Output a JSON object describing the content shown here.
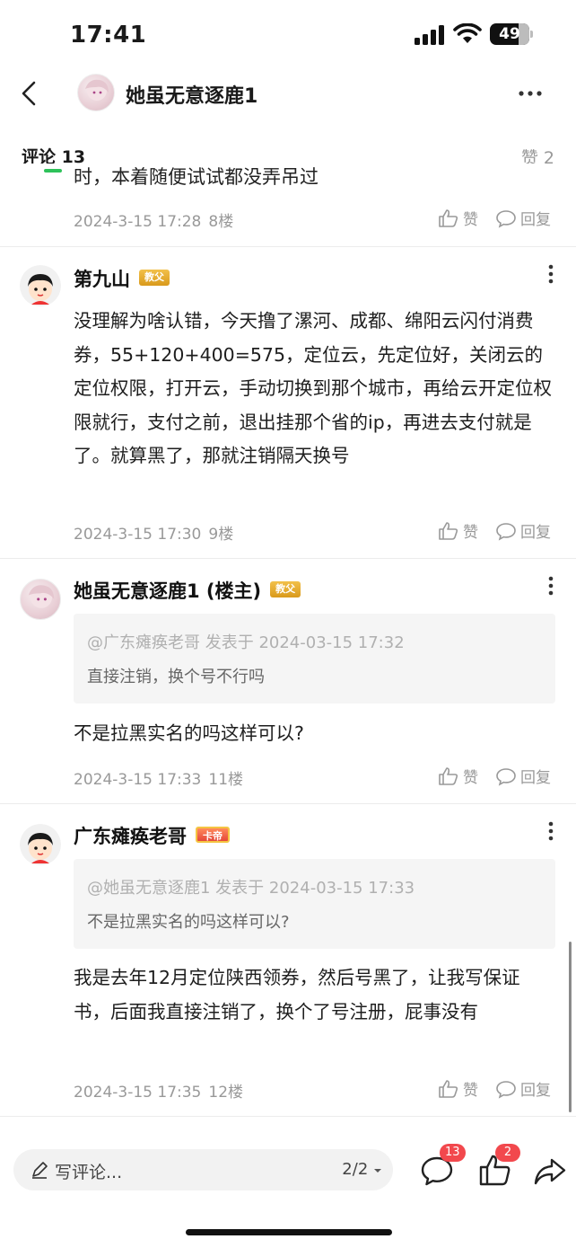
{
  "status_bar": {
    "time": "17:41",
    "battery": "49"
  },
  "nav": {
    "title": "她虽无意逐鹿1"
  },
  "tabs": {
    "comments_label": "评论",
    "comments_count": "13",
    "likes_label": "赞 2"
  },
  "clipped_text": "时，本着随便试试都没弄吊过",
  "actions": {
    "like": "赞",
    "reply": "回复"
  },
  "comments": [
    {
      "user": "第九山",
      "badge": "教父",
      "content": "没理解为啥认错，今天撸了漯河、成都、绵阳云闪付消费券，55+120+400=575，定位云，先定位好，关闭云的定位权限，打开云，手动切换到那个城市，再给云开定位权限就行，支付之前，退出挂那个省的ip，再进去支付就是了。就算黑了，那就注销隔天换号",
      "time": "2024-3-15 17:30",
      "floor": "9楼"
    },
    {
      "user": "她虽无意逐鹿1 (楼主)",
      "badge": "教父",
      "quote_head": "@广东瘫痪老哥 发表于 2024-03-15 17:32",
      "quote_body": "直接注销，换个号不行吗",
      "content": "不是拉黑实名的吗这样可以?",
      "time": "2024-3-15 17:33",
      "floor": "11楼"
    },
    {
      "user": "广东瘫痪老哥",
      "badge": "卡帝",
      "quote_head": "@她虽无意逐鹿1 发表于 2024-03-15 17:33",
      "quote_body": "不是拉黑实名的吗这样可以?",
      "content": "我是去年12月定位陕西领券，然后号黑了，让我写保证书，后面我直接注销了，换个了号注册，屁事没有",
      "time": "2024-3-15 17:35",
      "floor": "12楼"
    }
  ],
  "prev_comment": {
    "time": "2024-3-15 17:28",
    "floor": "8楼"
  },
  "bottom_bar": {
    "input_placeholder": "写评论...",
    "page": "2/2",
    "comment_count": "13",
    "like_count": "2"
  }
}
